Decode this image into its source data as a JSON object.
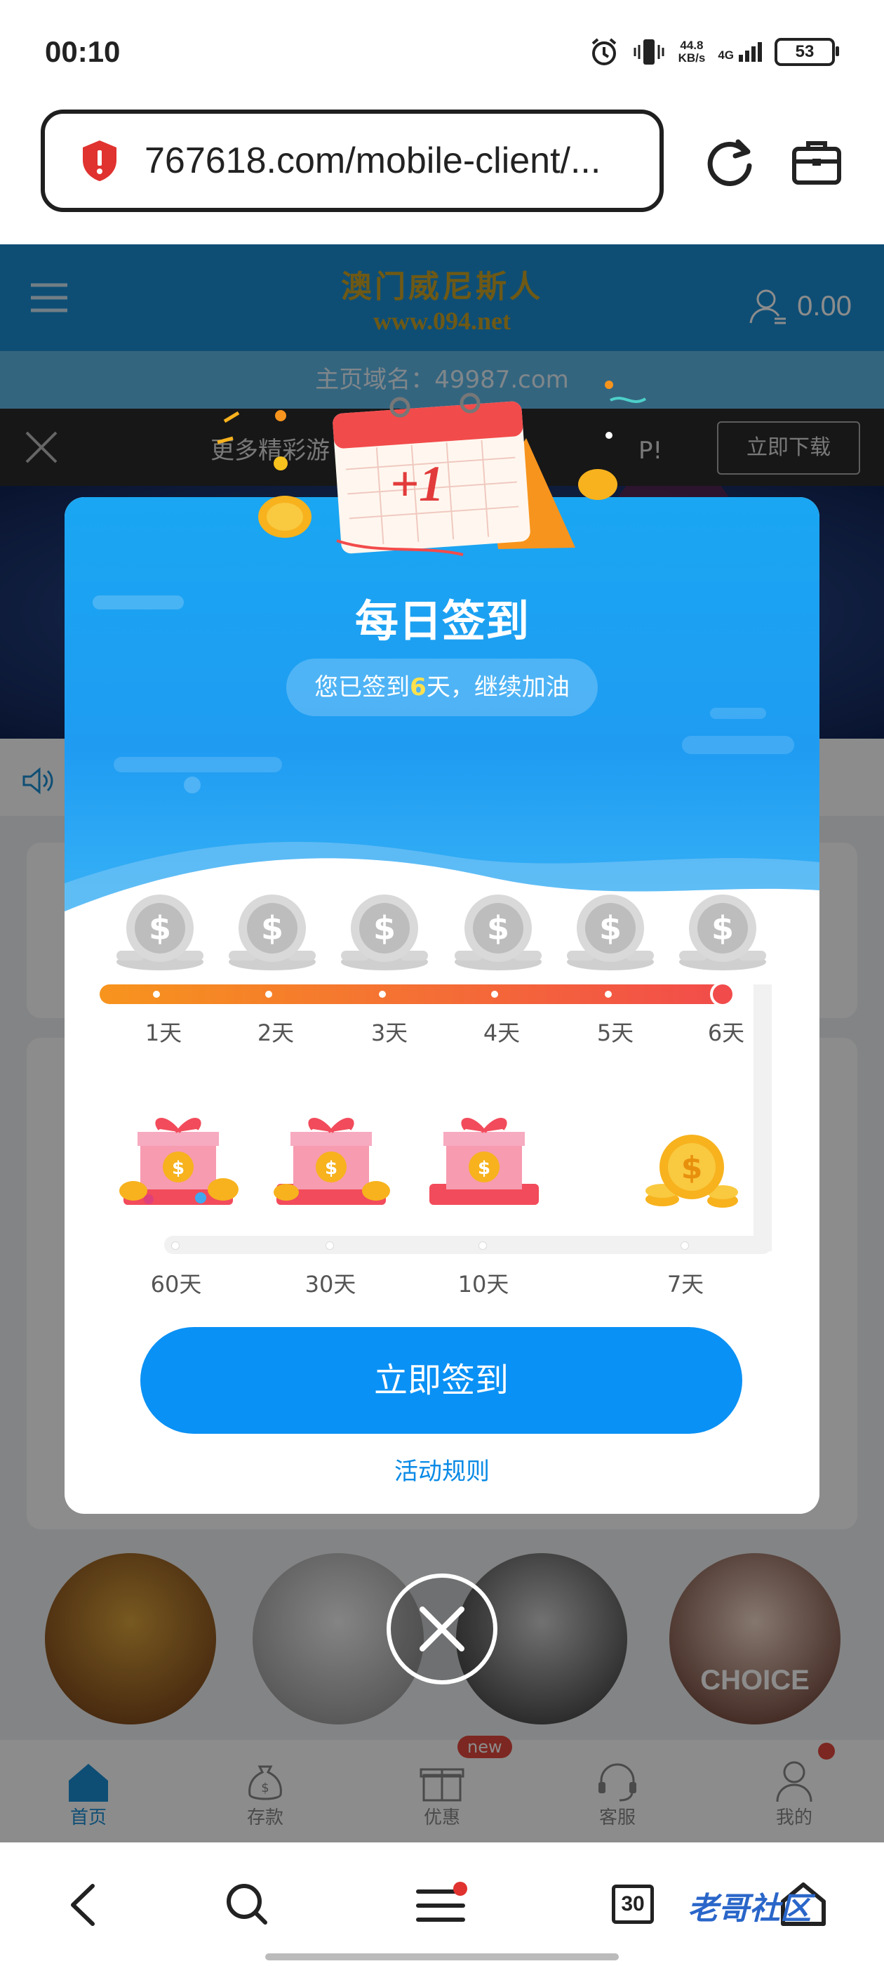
{
  "status_bar": {
    "time": "00:10",
    "net_speed": "44.8",
    "net_unit": "KB/s",
    "signal": "4G",
    "battery": "53"
  },
  "browser": {
    "url": "767618.com/mobile-client/..."
  },
  "site": {
    "logo_title": "澳门威尼斯人",
    "logo_url": "www.094.net",
    "balance": "0.00",
    "domain_text": "主页域名：49987.com",
    "download_text": "更多精彩游",
    "download_text_end": "P!",
    "download_button": "立即下载",
    "tabs": [
      {
        "label": "首页",
        "active": true
      },
      {
        "label": "存款"
      },
      {
        "label": "优惠"
      },
      {
        "label": "客服"
      },
      {
        "label": "我的"
      }
    ],
    "new_badge": "new",
    "avatar_labels": [
      "",
      "",
      "",
      "CHOICE"
    ]
  },
  "modal": {
    "title": "每日签到",
    "status_prefix": "您已签到",
    "status_days": "6",
    "status_suffix": "天，继续加油",
    "calendar_text": "+1",
    "day_labels_row1": [
      "1天",
      "2天",
      "3天",
      "4天",
      "5天",
      "6天"
    ],
    "day_labels_row2": [
      "60天",
      "30天",
      "10天",
      "7天"
    ],
    "sign_button": "立即签到",
    "rules_link": "活动规则"
  },
  "navbar": {
    "tabs_count": "30",
    "watermark": "老哥社区"
  },
  "colors": {
    "accent": "#0a91f5",
    "progress_start": "#f7941d",
    "progress_end": "#f24b4b",
    "highlight": "#ffe14d"
  }
}
